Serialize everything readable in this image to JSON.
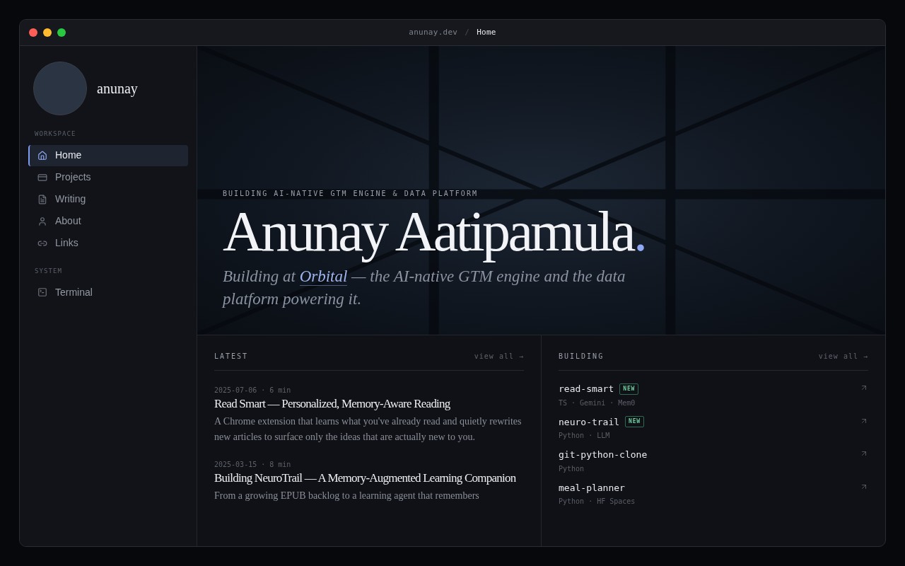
{
  "window": {
    "breadcrumb": [
      "anunay.dev",
      "Home"
    ],
    "separator": "/"
  },
  "sidebar": {
    "username": "anunay",
    "sections": [
      {
        "heading": "WORKSPACE",
        "items": [
          {
            "label": "Home",
            "kind": "home",
            "selected": true
          },
          {
            "label": "Projects",
            "kind": "projects",
            "selected": false
          },
          {
            "label": "Writing",
            "kind": "writing",
            "selected": false
          },
          {
            "label": "About",
            "kind": "about",
            "selected": false
          },
          {
            "label": "Links",
            "kind": "links",
            "selected": false
          }
        ]
      },
      {
        "heading": "SYSTEM",
        "items": [
          {
            "label": "Terminal",
            "kind": "terminal",
            "selected": false
          }
        ]
      }
    ]
  },
  "hero": {
    "eyebrow": "BUILDING AI-NATIVE GTM ENGINE & DATA PLATFORM",
    "name": "Anunay Aatipamula",
    "name_suffix": ".",
    "subtitle_before": "Building at",
    "subtitle_link": "Orbital",
    "subtitle_after": "— the AI-native GTM engine and the data platform powering it."
  },
  "latest": {
    "heading": "LATEST",
    "view_all": "view all →",
    "posts": [
      {
        "meta": "2025-07-06 · 6 min",
        "title": "Read Smart — Personalized, Memory-Aware Reading",
        "summary": "A Chrome extension that learns what you've already read and quietly rewrites new articles to surface only the ideas that are actually new to you."
      },
      {
        "meta": "2025-03-15 · 8 min",
        "title": "Building NeuroTrail — A Memory-Augmented Learning Companion",
        "summary": "From a growing EPUB backlog to a learning agent that remembers"
      }
    ]
  },
  "building": {
    "heading": "BUILDING",
    "view_all": "view all →",
    "projects": [
      {
        "name": "read-smart",
        "badge": "NEW",
        "stack": "TS · Gemini · Mem0"
      },
      {
        "name": "neuro-trail",
        "badge": "NEW",
        "stack": "Python · LLM"
      },
      {
        "name": "git-python-clone",
        "stack": "Python"
      },
      {
        "name": "meal-planner",
        "stack": "Python · HF Spaces"
      }
    ]
  }
}
